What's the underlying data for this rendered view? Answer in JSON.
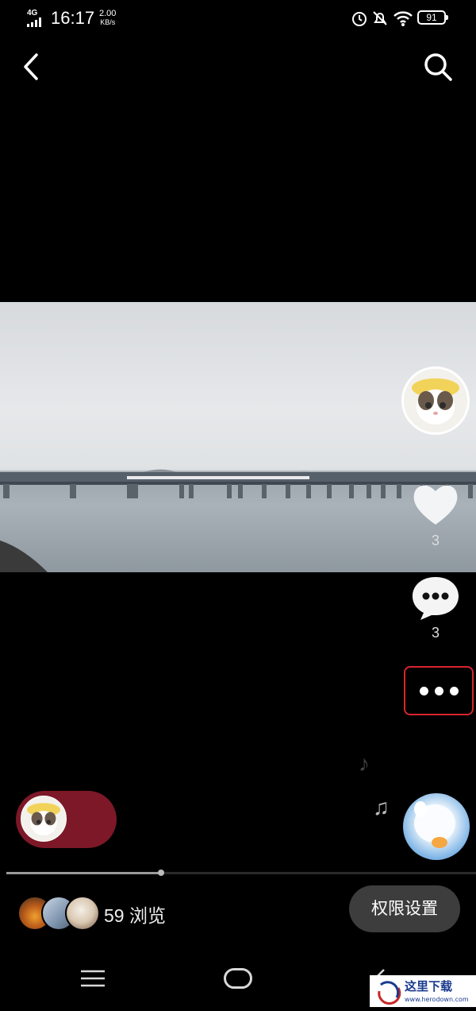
{
  "status_bar": {
    "network": "4G",
    "time": "16:17",
    "speed_value": "2.00",
    "speed_unit": "KB/s",
    "battery": "91"
  },
  "icons": {
    "back": "back-icon",
    "search": "search-icon",
    "like": "heart-icon",
    "comment": "comment-icon",
    "more": "more-icon"
  },
  "stats": {
    "like_count": "3",
    "comment_count": "3"
  },
  "playback": {
    "progress": 0.33
  },
  "footer": {
    "views_count": "59",
    "views_label": "浏览",
    "permission_button": "权限设置"
  },
  "watermark": {
    "brand": "这里下载",
    "url": "www.herodown.com"
  },
  "colors": {
    "accent_red": "#d9242f",
    "pill": "#7c1827",
    "button_bg": "#3d3d3d"
  }
}
